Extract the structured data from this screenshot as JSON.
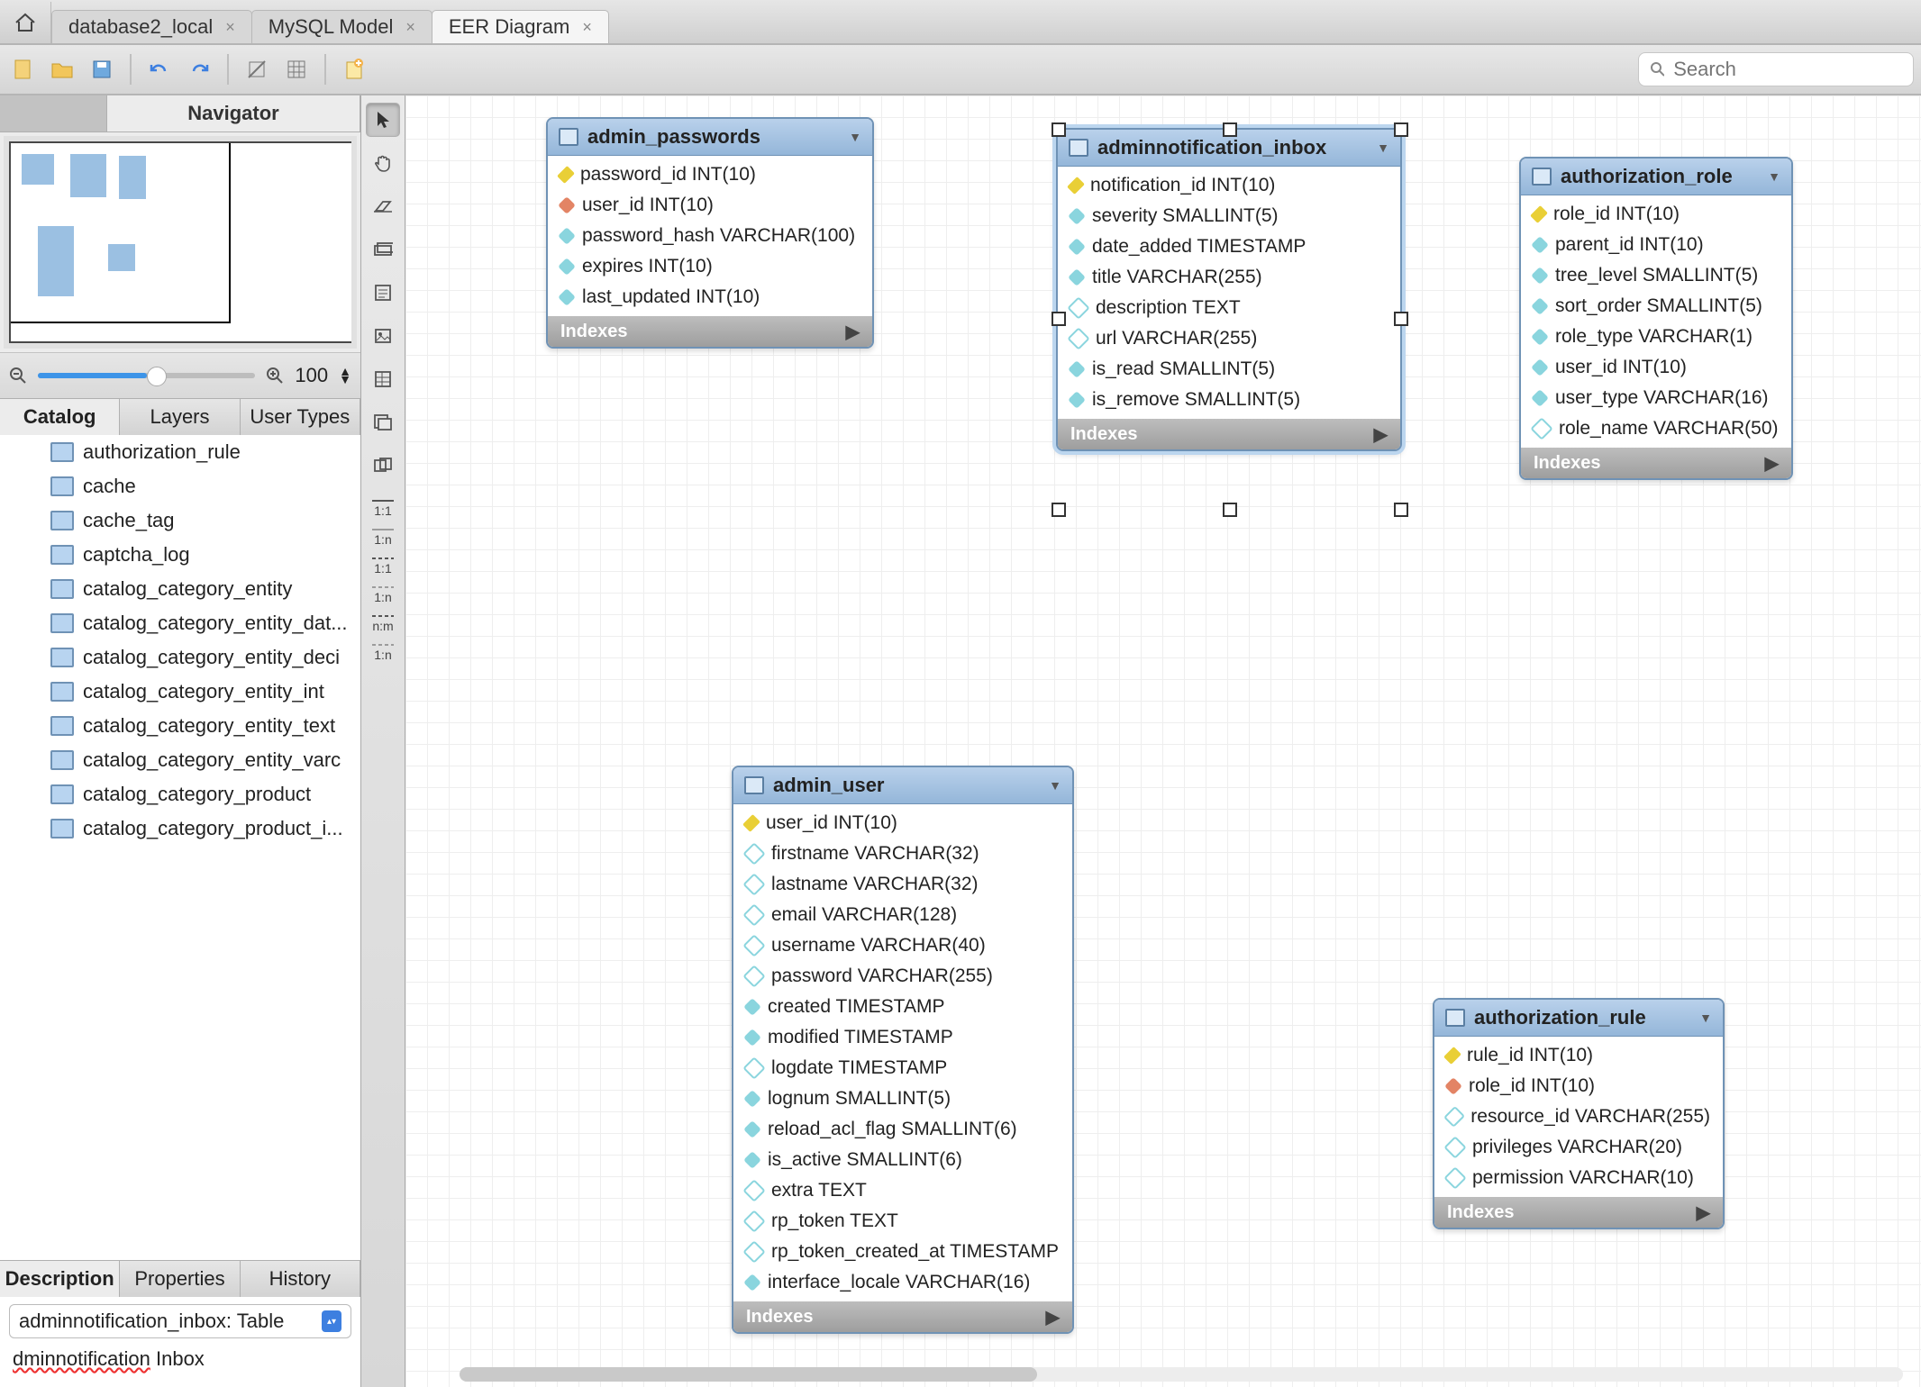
{
  "tabs": {
    "items": [
      {
        "label": "database2_local"
      },
      {
        "label": "MySQL Model"
      },
      {
        "label": "EER Diagram",
        "active": true
      }
    ]
  },
  "search": {
    "placeholder": "Search"
  },
  "navPanel": {
    "tab0": "",
    "tab1": "Navigator"
  },
  "zoom": {
    "value": "100"
  },
  "catalogTabs": {
    "t0": "Catalog",
    "t1": "Layers",
    "t2": "User Types"
  },
  "catalog": {
    "items": [
      "authorization_rule",
      "cache",
      "cache_tag",
      "captcha_log",
      "catalog_category_entity",
      "catalog_category_entity_dat...",
      "catalog_category_entity_deci",
      "catalog_category_entity_int",
      "catalog_category_entity_text",
      "catalog_category_entity_varc",
      "catalog_category_product",
      "catalog_category_product_i..."
    ]
  },
  "bottomTabs": {
    "t0": "Description",
    "t1": "Properties",
    "t2": "History"
  },
  "descSel": "adminnotification_inbox: Table",
  "descText": {
    "a": "dminnotification",
    "b": " Inbox"
  },
  "palette": {
    "rels": [
      "1:1",
      "1:n",
      "1:1",
      "1:n",
      "n:m",
      "1:n"
    ]
  },
  "tables": {
    "admin_passwords": {
      "title": "admin_passwords",
      "cols": [
        {
          "k": "key",
          "t": "password_id INT(10)"
        },
        {
          "k": "red",
          "t": "user_id INT(10)"
        },
        {
          "k": "cyan",
          "t": "password_hash VARCHAR(100)"
        },
        {
          "k": "cyan",
          "t": "expires INT(10)"
        },
        {
          "k": "cyan",
          "t": "last_updated INT(10)"
        }
      ],
      "foot": "Indexes"
    },
    "adminnotification_inbox": {
      "title": "adminnotification_inbox",
      "cols": [
        {
          "k": "key",
          "t": "notification_id INT(10)"
        },
        {
          "k": "cyan",
          "t": "severity SMALLINT(5)"
        },
        {
          "k": "cyan",
          "t": "date_added TIMESTAMP"
        },
        {
          "k": "cyan",
          "t": "title VARCHAR(255)"
        },
        {
          "k": "lcyan",
          "t": "description TEXT"
        },
        {
          "k": "lcyan",
          "t": "url VARCHAR(255)"
        },
        {
          "k": "cyan",
          "t": "is_read SMALLINT(5)"
        },
        {
          "k": "cyan",
          "t": "is_remove SMALLINT(5)"
        }
      ],
      "foot": "Indexes"
    },
    "authorization_role": {
      "title": "authorization_role",
      "cols": [
        {
          "k": "key",
          "t": "role_id INT(10)"
        },
        {
          "k": "cyan",
          "t": "parent_id INT(10)"
        },
        {
          "k": "cyan",
          "t": "tree_level SMALLINT(5)"
        },
        {
          "k": "cyan",
          "t": "sort_order SMALLINT(5)"
        },
        {
          "k": "cyan",
          "t": "role_type VARCHAR(1)"
        },
        {
          "k": "cyan",
          "t": "user_id INT(10)"
        },
        {
          "k": "cyan",
          "t": "user_type VARCHAR(16)"
        },
        {
          "k": "lcyan",
          "t": "role_name VARCHAR(50)"
        }
      ],
      "foot": "Indexes"
    },
    "admin_user": {
      "title": "admin_user",
      "cols": [
        {
          "k": "key",
          "t": "user_id INT(10)"
        },
        {
          "k": "lcyan",
          "t": "firstname VARCHAR(32)"
        },
        {
          "k": "lcyan",
          "t": "lastname VARCHAR(32)"
        },
        {
          "k": "lcyan",
          "t": "email VARCHAR(128)"
        },
        {
          "k": "lcyan",
          "t": "username VARCHAR(40)"
        },
        {
          "k": "lcyan",
          "t": "password VARCHAR(255)"
        },
        {
          "k": "cyan",
          "t": "created TIMESTAMP"
        },
        {
          "k": "cyan",
          "t": "modified TIMESTAMP"
        },
        {
          "k": "lcyan",
          "t": "logdate TIMESTAMP"
        },
        {
          "k": "cyan",
          "t": "lognum SMALLINT(5)"
        },
        {
          "k": "cyan",
          "t": "reload_acl_flag SMALLINT(6)"
        },
        {
          "k": "cyan",
          "t": "is_active SMALLINT(6)"
        },
        {
          "k": "lcyan",
          "t": "extra TEXT"
        },
        {
          "k": "lcyan",
          "t": "rp_token TEXT"
        },
        {
          "k": "lcyan",
          "t": "rp_token_created_at TIMESTAMP"
        },
        {
          "k": "cyan",
          "t": "interface_locale VARCHAR(16)"
        }
      ],
      "foot": "Indexes"
    },
    "authorization_rule": {
      "title": "authorization_rule",
      "cols": [
        {
          "k": "key",
          "t": "rule_id INT(10)"
        },
        {
          "k": "red",
          "t": "role_id INT(10)"
        },
        {
          "k": "lcyan",
          "t": "resource_id VARCHAR(255)"
        },
        {
          "k": "lcyan",
          "t": "privileges VARCHAR(20)"
        },
        {
          "k": "lcyan",
          "t": "permission VARCHAR(10)"
        }
      ],
      "foot": "Indexes"
    }
  }
}
